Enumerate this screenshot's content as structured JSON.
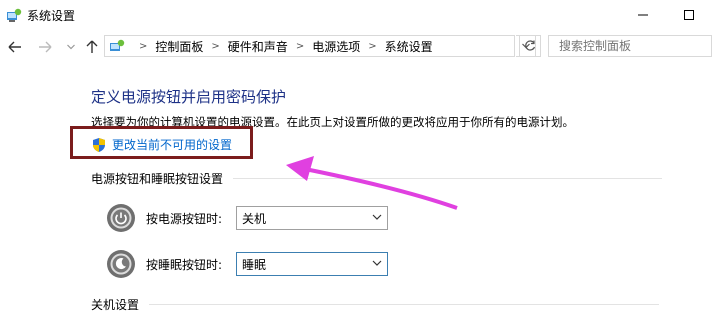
{
  "window": {
    "title": "系统设置",
    "minimize_glyph": "—",
    "maximize_glyph": "☐"
  },
  "nav": {
    "back_icon": "back-arrow-icon",
    "forward_icon": "forward-arrow-icon",
    "recent_icon": "chevron-down-icon",
    "up_icon": "up-arrow-icon"
  },
  "address": {
    "crumbs": [
      "控制面板",
      "硬件和声音",
      "电源选项",
      "系统设置"
    ]
  },
  "search": {
    "placeholder": "搜索控制面板"
  },
  "main": {
    "heading": "定义电源按钮并启用密码保护",
    "description": "选择要为你的计算机设置的电源设置。在此页上对设置所做的更改将应用于你所有的电源计划。",
    "change_link": "更改当前不可用的设置",
    "section_buttons": "电源按钮和睡眠按钮设置",
    "section_shutdown": "关机设置",
    "power_button_label": "按电源按钮时:",
    "power_button_value": "关机",
    "sleep_button_label": "按睡眠按钮时:",
    "sleep_button_value": "睡眠"
  },
  "colors": {
    "heading": "#1e3287",
    "link": "#0066cc",
    "highlight_box": "#7b1c1c",
    "arrow": "#e040e0"
  }
}
